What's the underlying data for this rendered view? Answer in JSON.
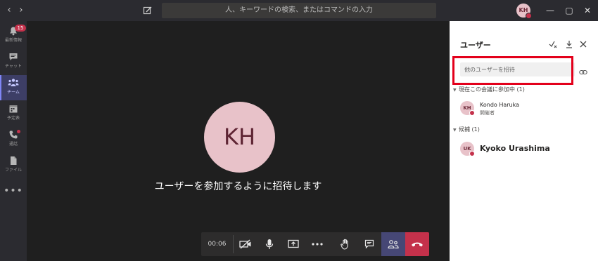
{
  "titlebar": {
    "search_placeholder": "人、キーワードの検索、またはコマンドの入力",
    "user_initials": "KH",
    "back_glyph": "‹",
    "forward_glyph": "›",
    "minimize_glyph": "—",
    "maximize_glyph": "▢",
    "close_glyph": "✕"
  },
  "rail": {
    "items": [
      {
        "label": "最新情報",
        "icon": "bell-icon",
        "badge": "15"
      },
      {
        "label": "チャット",
        "icon": "chat-icon"
      },
      {
        "label": "チーム",
        "icon": "teams-icon",
        "active": true
      },
      {
        "label": "予定表",
        "icon": "calendar-icon"
      },
      {
        "label": "通話",
        "icon": "phone-icon",
        "dot": true
      },
      {
        "label": "ファイル",
        "icon": "file-icon"
      }
    ],
    "more_glyph": "•••"
  },
  "stage": {
    "avatar_initials": "KH",
    "message": "ユーザーを参加するように招待します"
  },
  "controls": {
    "timer": "00:06"
  },
  "panel": {
    "title": "ユーザー",
    "invite_placeholder": "他のユーザーを招待",
    "in_meeting_header": "現在この会議に参加中 (1)",
    "suggested_header": "候補 (1)",
    "caret_glyph": "▼",
    "in_meeting": [
      {
        "initials": "KH",
        "name": "Kondo Haruka",
        "role": "開催者"
      }
    ],
    "suggested": [
      {
        "initials": "UK",
        "name": "Kyoko Urashima"
      }
    ]
  },
  "colors": {
    "accent": "#464775",
    "hangup": "#c4314b",
    "highlight": "#e3001b",
    "avatar_bg": "#e8c2c9"
  }
}
